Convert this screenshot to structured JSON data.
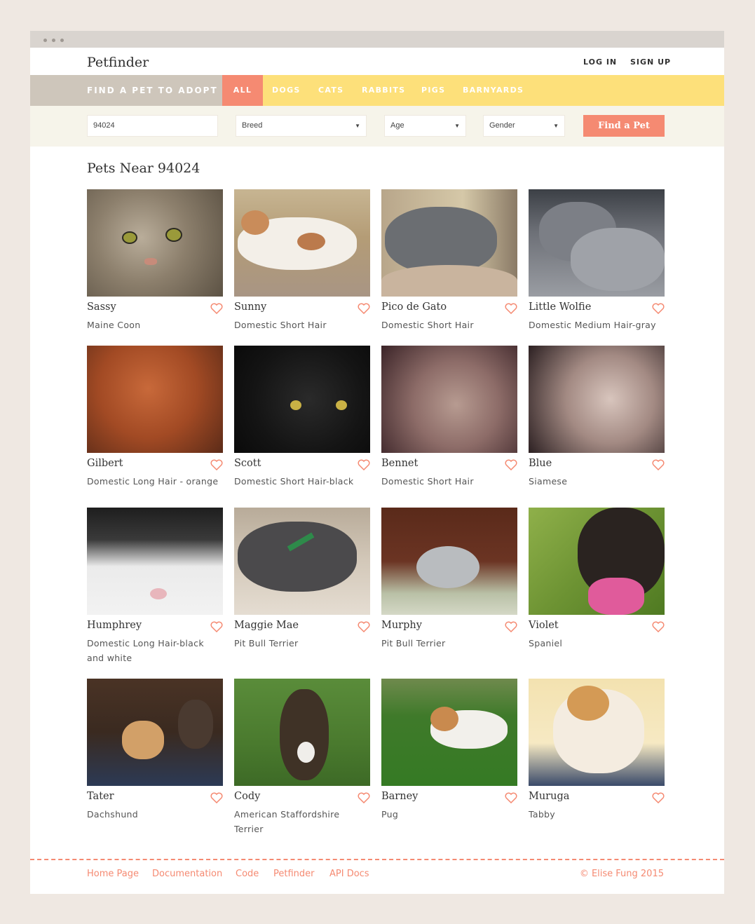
{
  "app": {
    "logo": "Petfinder"
  },
  "header": {
    "login": "LOG IN",
    "signup": "SIGN UP"
  },
  "nav": {
    "find_label": "FIND A PET TO ADOPT",
    "tabs": [
      "ALL",
      "DOGS",
      "CATS",
      "RABBITS",
      "PIGS",
      "BARNYARDS"
    ]
  },
  "filters": {
    "zip": "94024",
    "breed": "Breed",
    "age": "Age",
    "gender": "Gender",
    "button": "Find a Pet"
  },
  "heading": "Pets Near 94024",
  "pets": [
    {
      "name": "Sassy",
      "breed": "Maine Coon"
    },
    {
      "name": "Sunny",
      "breed": "Domestic Short Hair"
    },
    {
      "name": "Pico de Gato",
      "breed": "Domestic Short Hair"
    },
    {
      "name": "Little Wolfie",
      "breed": "Domestic Medium Hair-gray"
    },
    {
      "name": "Gilbert",
      "breed": "Domestic Long Hair - orange"
    },
    {
      "name": "Scott",
      "breed": "Domestic Short Hair-black"
    },
    {
      "name": "Bennet",
      "breed": "Domestic Short Hair"
    },
    {
      "name": "Blue",
      "breed": "Siamese"
    },
    {
      "name": "Humphrey",
      "breed": "Domestic Long Hair-black and white"
    },
    {
      "name": "Maggie Mae",
      "breed": "Pit Bull Terrier"
    },
    {
      "name": "Murphy",
      "breed": "Pit Bull Terrier"
    },
    {
      "name": "Violet",
      "breed": "Spaniel"
    },
    {
      "name": "Tater",
      "breed": "Dachshund"
    },
    {
      "name": "Cody",
      "breed": "American Staffordshire Terrier"
    },
    {
      "name": "Barney",
      "breed": "Pug"
    },
    {
      "name": "Muruga",
      "breed": "Tabby"
    }
  ],
  "footer": {
    "links": [
      "Home Page",
      "Documentation",
      "Code",
      "Petfinder",
      "API Docs"
    ],
    "copyright": "© Elise Fung 2015"
  },
  "colors": {
    "accent": "#f58a72",
    "nav": "#fde07a",
    "find_bg": "#cec6bb"
  }
}
